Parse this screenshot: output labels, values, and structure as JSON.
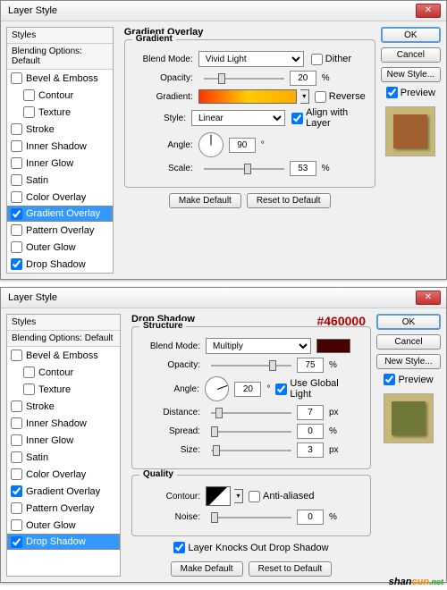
{
  "dialogs": [
    {
      "title": "Layer Style",
      "sidebar": {
        "h1": "Styles",
        "h2": "Blending Options: Default",
        "items": [
          {
            "label": "Bevel & Emboss",
            "chk": false
          },
          {
            "label": "Contour",
            "chk": false,
            "sub": true
          },
          {
            "label": "Texture",
            "chk": false,
            "sub": true
          },
          {
            "label": "Stroke",
            "chk": false
          },
          {
            "label": "Inner Shadow",
            "chk": false
          },
          {
            "label": "Inner Glow",
            "chk": false
          },
          {
            "label": "Satin",
            "chk": false
          },
          {
            "label": "Color Overlay",
            "chk": false
          },
          {
            "label": "Gradient Overlay",
            "chk": true,
            "sel": true
          },
          {
            "label": "Pattern Overlay",
            "chk": false
          },
          {
            "label": "Outer Glow",
            "chk": false
          },
          {
            "label": "Drop Shadow",
            "chk": true
          }
        ]
      },
      "panel": {
        "title": "Gradient Overlay",
        "group": "Gradient",
        "blend_lbl": "Blend Mode:",
        "blend": "Vivid Light",
        "dither": "Dither",
        "opac_lbl": "Opacity:",
        "opac": "20",
        "pct": "%",
        "grad_lbl": "Gradient:",
        "rev": "Reverse",
        "style_lbl": "Style:",
        "style": "Linear",
        "align": "Align with Layer",
        "align_chk": true,
        "angle_lbl": "Angle:",
        "angle": "90",
        "deg": "°",
        "scale_lbl": "Scale:",
        "scale": "53",
        "b1": "Make Default",
        "b2": "Reset to Default"
      },
      "right": {
        "ok": "OK",
        "cancel": "Cancel",
        "new": "New Style...",
        "preview": "Preview",
        "prev_chk": true
      }
    },
    {
      "title": "Layer Style",
      "sidebar": {
        "h1": "Styles",
        "h2": "Blending Options: Default",
        "items": [
          {
            "label": "Bevel & Emboss",
            "chk": false
          },
          {
            "label": "Contour",
            "chk": false,
            "sub": true
          },
          {
            "label": "Texture",
            "chk": false,
            "sub": true
          },
          {
            "label": "Stroke",
            "chk": false
          },
          {
            "label": "Inner Shadow",
            "chk": false
          },
          {
            "label": "Inner Glow",
            "chk": false
          },
          {
            "label": "Satin",
            "chk": false
          },
          {
            "label": "Color Overlay",
            "chk": false
          },
          {
            "label": "Gradient Overlay",
            "chk": true
          },
          {
            "label": "Pattern Overlay",
            "chk": false
          },
          {
            "label": "Outer Glow",
            "chk": false
          },
          {
            "label": "Drop Shadow",
            "chk": true,
            "sel": true
          }
        ]
      },
      "panel": {
        "title": "Drop Shadow",
        "group": "Structure",
        "anno": "#460000",
        "blend_lbl": "Blend Mode:",
        "blend": "Multiply",
        "color": "#460000",
        "opac_lbl": "Opacity:",
        "opac": "75",
        "pct": "%",
        "angle_lbl": "Angle:",
        "angle": "20",
        "deg": "°",
        "ugl": "Use Global Light",
        "ugl_chk": true,
        "dist_lbl": "Distance:",
        "dist": "7",
        "px": "px",
        "spread_lbl": "Spread:",
        "spread": "0",
        "size_lbl": "Size:",
        "size": "3",
        "group2": "Quality",
        "cont_lbl": "Contour:",
        "aa": "Anti-aliased",
        "noise_lbl": "Noise:",
        "noise": "0",
        "knock": "Layer Knocks Out Drop Shadow",
        "knock_chk": true,
        "b1": "Make Default",
        "b2": "Reset to Default"
      },
      "right": {
        "ok": "OK",
        "cancel": "Cancel",
        "new": "New Style...",
        "preview": "Preview",
        "prev_chk": true
      }
    }
  ],
  "watermark": {
    "a": "shan",
    "b": "cun",
    "c": ".net"
  }
}
